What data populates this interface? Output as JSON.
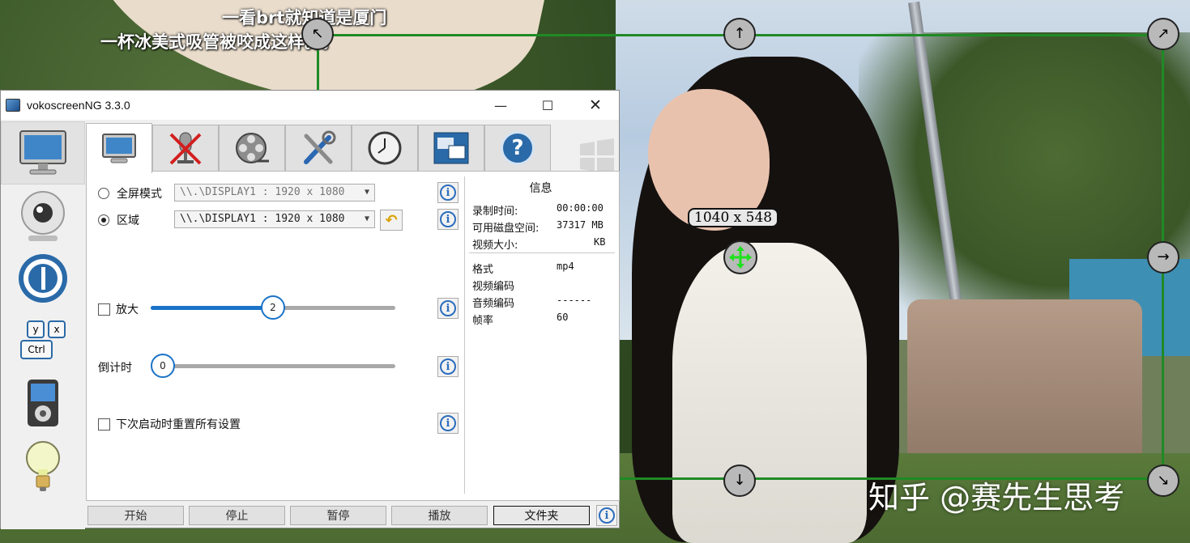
{
  "background": {
    "subtitle_line1": "一看brt就知道是厦门",
    "subtitle_line2": "一杯冰美式吸管被咬成这样。。。",
    "watermark": "知乎 @赛先生思考"
  },
  "selection": {
    "size_label": "1040 x 548",
    "color": "#1f8a25"
  },
  "window": {
    "title": "vokoscreenNG 3.3.0",
    "controls": {
      "minimize": "—",
      "maximize": "☐",
      "close": "✕"
    }
  },
  "sidebar": {
    "items": [
      {
        "name": "screen",
        "icon": "monitor-icon"
      },
      {
        "name": "camera",
        "icon": "webcam-icon"
      },
      {
        "name": "player",
        "icon": "player-icon"
      },
      {
        "name": "keyboard",
        "icon": "keyboard-icon",
        "keys": [
          "y",
          "x",
          "Ctrl"
        ]
      },
      {
        "name": "media",
        "icon": "media-player-icon"
      },
      {
        "name": "tips",
        "icon": "lightbulb-icon"
      }
    ]
  },
  "tabs": [
    {
      "name": "screen",
      "icon": "monitor-icon"
    },
    {
      "name": "audio",
      "icon": "microphone-muted-icon"
    },
    {
      "name": "video",
      "icon": "film-reel-icon"
    },
    {
      "name": "tools",
      "icon": "tools-icon"
    },
    {
      "name": "timer",
      "icon": "clock-icon"
    },
    {
      "name": "windows",
      "icon": "windows-icon"
    },
    {
      "name": "help",
      "icon": "help-icon",
      "glyph": "?"
    }
  ],
  "screen_panel": {
    "fullscreen_label": "全屏模式",
    "fullscreen_display": "\\\\.\\DISPLAY1 :  1920 x 1080",
    "region_label": "区域",
    "region_display": "\\\\.\\DISPLAY1 :  1920 x 1080",
    "magnify_label": "放大",
    "magnify_value": "2",
    "magnify_level": 0.5,
    "countdown_label": "倒计时",
    "countdown_value": "0",
    "reset_label": "下次启动时重置所有设置",
    "info_glyph": "i"
  },
  "info_panel": {
    "title": "信息",
    "rows": [
      {
        "key": "录制时间:",
        "value": "00:00:00"
      },
      {
        "key": "可用磁盘空间:",
        "value": "37317 MB"
      },
      {
        "key": "视频大小:",
        "value": "KB"
      }
    ],
    "rows2": [
      {
        "key": "格式",
        "value": "mp4"
      },
      {
        "key": "视频编码",
        "value": ""
      },
      {
        "key": "音频编码",
        "value": "------"
      },
      {
        "key": "帧率",
        "value": "60"
      }
    ]
  },
  "bottom_buttons": {
    "start": "开始",
    "stop": "停止",
    "pause": "暂停",
    "play": "播放",
    "folder": "文件夹"
  }
}
